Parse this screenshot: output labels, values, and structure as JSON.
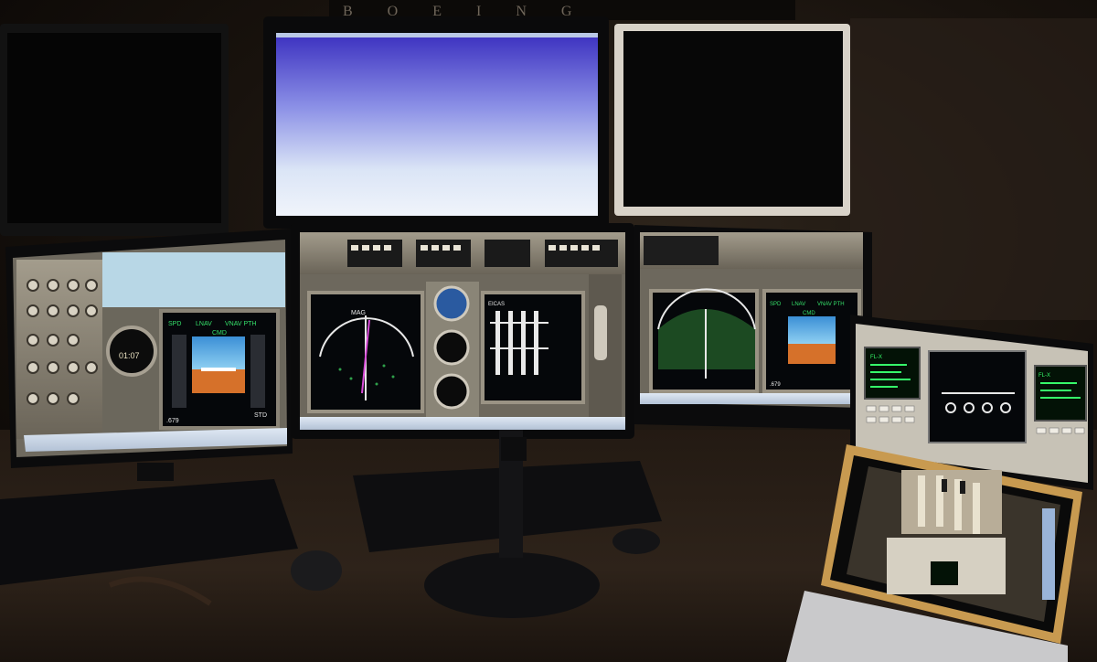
{
  "scene": {
    "description_tags": [
      "home-flight-sim",
      "boeing-747-cockpit"
    ]
  },
  "wall_sign": {
    "text": "BOEING"
  },
  "monitors": {
    "top_center": {
      "content": "sky-view"
    },
    "left": {
      "pfd": {
        "spd_mode": "SPD",
        "lnav": "LNAV",
        "vnav": "VNAV PTH",
        "cmd": "CMD",
        "baro": "STD",
        "mach": ".679"
      },
      "clock": {
        "readout": "01:07"
      }
    },
    "center": {
      "nd": {
        "label": "MAG"
      },
      "eicas": {
        "label": "EICAS"
      }
    },
    "right": {
      "pfd": {
        "spd_mode": "SPD",
        "lnav": "LNAV",
        "vnav": "VNAV PTH",
        "cmd": "CMD",
        "mach": ".679"
      }
    },
    "laptop": {
      "cdu_left": {
        "label": "FL-X"
      },
      "cdu_right": {
        "label": "FL-X"
      }
    }
  },
  "colors": {
    "sky_top": "#3a2fbf",
    "sky_bottom": "#eef3fb",
    "pfd_sky": "#3b8fd6",
    "pfd_ground": "#d6712a",
    "cdu_text": "#36ff6a",
    "nd_magenta": "#d94bd9"
  }
}
